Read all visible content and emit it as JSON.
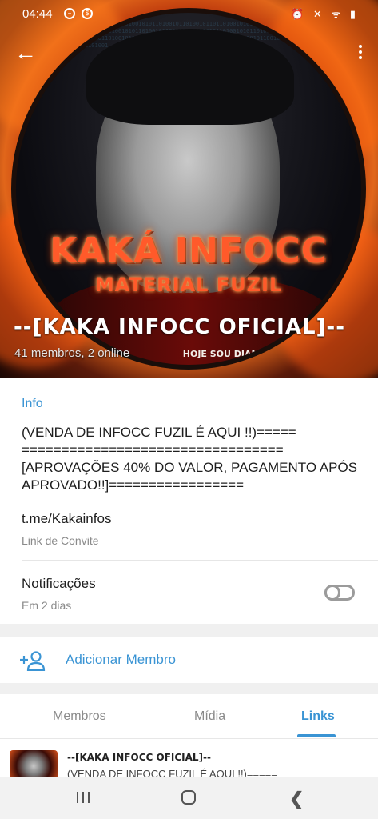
{
  "status_bar": {
    "time": "04:44",
    "right_icons": "⏰ ✕ ᯤ ▮"
  },
  "header": {
    "poster_title": "KAKÁ INFOCC",
    "poster_subtitle": "MATERIAL FUZIL",
    "poster_tagline": "HOJE SOU DIAMANTE!",
    "group_name": "--[KAKA INFOCC OFICIAL]--",
    "members": "41 membros, 2 online"
  },
  "info": {
    "heading": "Info",
    "description": "(VENDA DE INFOCC FUZIL É AQUI !!)===== ================================= [APROVAÇÕES 40% DO VALOR, PAGAMENTO APÓS APROVADO!!]=================",
    "link": "t.me/Kakainfos",
    "link_label": "Link de Convite",
    "notifications_label": "Notificações",
    "notifications_sub": "Em 2 dias",
    "notifications_on": false
  },
  "add_member": {
    "label": "Adicionar Membro"
  },
  "tabs": [
    {
      "label": "Membros",
      "active": false
    },
    {
      "label": "Mídia",
      "active": false
    },
    {
      "label": "Links",
      "active": true
    }
  ],
  "links_list": [
    {
      "title": "--[KAKA INFOCC OFICIAL]--",
      "desc": "(VENDA DE INFOCC FUZIL É AQUI !!)====="
    }
  ],
  "colors": {
    "accent": "#3a94d4",
    "text": "#1e1e1e",
    "muted": "#8a8a8a"
  }
}
